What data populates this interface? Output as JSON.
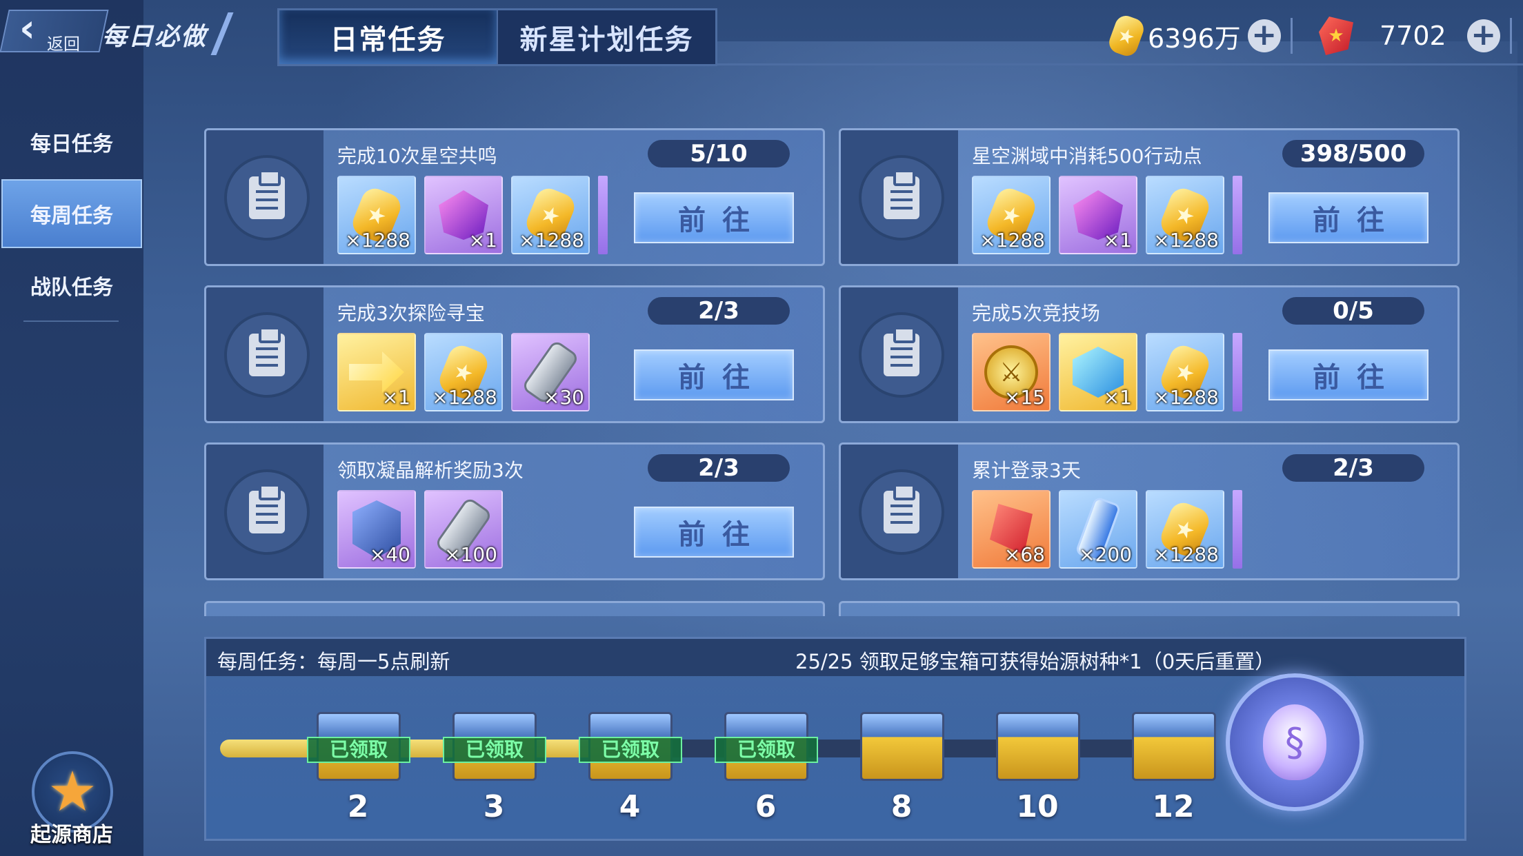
{
  "header": {
    "back_label": "返回",
    "page_title": "每日必做",
    "tabs": [
      {
        "label": "日常任务",
        "active": true
      },
      {
        "label": "新星计划任务",
        "active": false
      }
    ],
    "currencies": [
      {
        "icon": "gold-coin-icon",
        "value": "6396万"
      },
      {
        "icon": "ruby-gem-icon",
        "value": "7702"
      }
    ]
  },
  "sidebar": {
    "items": [
      {
        "label": "每日任务",
        "active": false
      },
      {
        "label": "每周任务",
        "active": true
      },
      {
        "label": "战队任务",
        "active": false
      }
    ],
    "shop_label": "起源商店"
  },
  "tasks": [
    {
      "title": "完成10次星空共鸣",
      "progress": "5/10",
      "button": "前往",
      "rewards": [
        {
          "icon": "gold-coin-icon",
          "qty": "×1288"
        },
        {
          "icon": "purple-gem-icon",
          "qty": "×1"
        },
        {
          "icon": "gold-coin-icon",
          "qty": "×1288"
        }
      ]
    },
    {
      "title": "星空渊域中消耗500行动点",
      "progress": "398/500",
      "button": "前往",
      "rewards": [
        {
          "icon": "gold-coin-icon",
          "qty": "×1288"
        },
        {
          "icon": "purple-gem-icon",
          "qty": "×1"
        },
        {
          "icon": "gold-coin-icon",
          "qty": "×1288"
        }
      ]
    },
    {
      "title": "完成3次探险寻宝",
      "progress": "2/3",
      "button": "前往",
      "rewards": [
        {
          "icon": "gold-arrow-icon",
          "qty": "×1"
        },
        {
          "icon": "gold-coin-icon",
          "qty": "×1288"
        },
        {
          "icon": "hourglass-icon",
          "qty": "×30"
        }
      ]
    },
    {
      "title": "完成5次竞技场",
      "progress": "0/5",
      "button": "前往",
      "rewards": [
        {
          "icon": "sword-medal-icon",
          "qty": "×15"
        },
        {
          "icon": "blue-cube-icon",
          "qty": "×1"
        },
        {
          "icon": "gold-coin-icon",
          "qty": "×1288"
        }
      ]
    },
    {
      "title": "领取凝晶解析奖励3次",
      "progress": "2/3",
      "button": "前往",
      "rewards": [
        {
          "icon": "blue-shield-icon",
          "qty": "×40"
        },
        {
          "icon": "hourglass-icon",
          "qty": "×100"
        }
      ]
    },
    {
      "title": "累计登录3天",
      "progress": "2/3",
      "button": "",
      "rewards": [
        {
          "icon": "ruby-shard-icon",
          "qty": "×68"
        },
        {
          "icon": "energy-tube-icon",
          "qty": "×200"
        },
        {
          "icon": "gold-coin-icon",
          "qty": "×1288"
        }
      ]
    }
  ],
  "weekly_panel": {
    "refresh_note": "每周任务：每周一5点刷新",
    "chest_note": "25/25 领取足够宝箱可获得始源树种*1（0天后重置）",
    "progress_fraction": 0.44,
    "chests": [
      {
        "threshold": "2",
        "claimed": true,
        "claimed_label": "已领取"
      },
      {
        "threshold": "3",
        "claimed": true,
        "claimed_label": "已领取"
      },
      {
        "threshold": "4",
        "claimed": true,
        "claimed_label": "已领取"
      },
      {
        "threshold": "6",
        "claimed": true,
        "claimed_label": "已领取"
      },
      {
        "threshold": "8",
        "claimed": false,
        "claimed_label": ""
      },
      {
        "threshold": "10",
        "claimed": false,
        "claimed_label": ""
      },
      {
        "threshold": "12",
        "claimed": false,
        "claimed_label": ""
      }
    ],
    "final_reward_icon": "origin-tree-seed-icon"
  }
}
